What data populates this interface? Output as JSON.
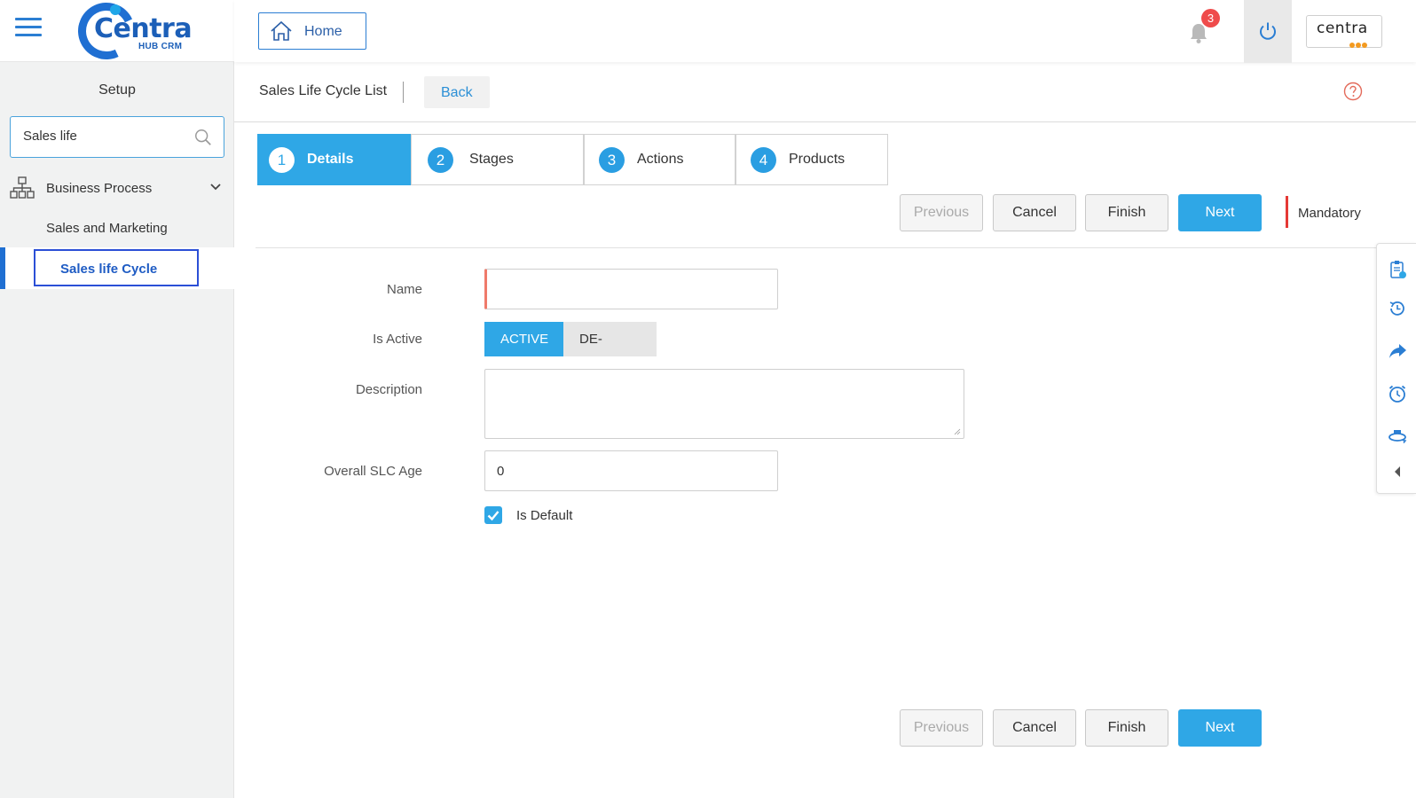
{
  "app": {
    "logo_text": "Centra",
    "logo_sub": "HUB CRM",
    "corner_logo_text": "centra"
  },
  "topbar": {
    "home_label": "Home",
    "notification_count": "3"
  },
  "sidebar": {
    "setup_title": "Setup",
    "search_value": "Sales life",
    "group_label": "Business Process",
    "sub_item": "Sales and Marketing",
    "active_item": "Sales life Cycle"
  },
  "page": {
    "title": "Sales Life Cycle List",
    "back_label": "Back"
  },
  "wizard": {
    "tabs": [
      {
        "num": "1",
        "label": "Details"
      },
      {
        "num": "2",
        "label": "Stages"
      },
      {
        "num": "3",
        "label": "Actions"
      },
      {
        "num": "4",
        "label": "Products"
      }
    ]
  },
  "buttons": {
    "previous": "Previous",
    "cancel": "Cancel",
    "finish": "Finish",
    "next": "Next",
    "mandatory": "Mandatory"
  },
  "form": {
    "name_label": "Name",
    "name_value": "",
    "is_active_label": "Is Active",
    "active_option": "ACTIVE",
    "deactive_option": "DE-ACTIVE",
    "description_label": "Description",
    "description_value": "",
    "age_label": "Overall SLC Age",
    "age_value": "0",
    "is_default_label": "Is Default",
    "is_default_checked": true
  },
  "rail_icons": [
    "notes-icon",
    "history-icon",
    "share-icon",
    "alarm-icon",
    "360-view-icon",
    "collapse-arrow-icon"
  ],
  "colors": {
    "primary": "#2fa7e6",
    "brand": "#1f6fd2",
    "mandatory": "#e53935",
    "badge": "#ef4b4b"
  }
}
